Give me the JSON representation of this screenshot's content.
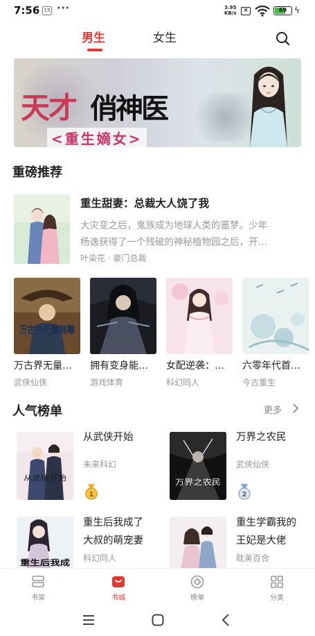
{
  "status_bar": {
    "time": "7:56",
    "badge": "15",
    "dots": "···",
    "speed_value": "3.95",
    "speed_unit": "KB/s",
    "battery": "69",
    "battery_level": 0.69
  },
  "top_tabs": {
    "male": "男生",
    "female": "女生",
    "active": "male"
  },
  "banner": {
    "title_part1": "天才",
    "title_part2": "俏神医",
    "subtitle": "<重生嫡女>"
  },
  "featured": {
    "section_title": "重磅推荐",
    "book": {
      "title": "重生甜妻：总裁大人饶了我",
      "desc_line1": "大灾变之后，鬼族成为地球人类的噩梦。少年",
      "desc_line2": "杨逸获得了一个残破的神秘植物园之后，开…",
      "author": "叶染花",
      "separator": "·",
      "category": "豪门总裁"
    },
    "grid": [
      {
        "title": "万古界无量…",
        "tag": "武侠仙侠",
        "cover_text": "万古界无量剑尊"
      },
      {
        "title": "拥有变身能…",
        "tag": "游戏体育"
      },
      {
        "title": "女配逆袭：…",
        "tag": "科幻同人"
      },
      {
        "title": "六零年代首…",
        "tag": "今古重生"
      }
    ]
  },
  "ranking": {
    "section_title": "人气榜单",
    "more": "更多",
    "items": [
      {
        "title_line1": "从武侠开始",
        "title_line2": "",
        "tag": "未来科幻",
        "rank": "1",
        "cover_text": "从武侠开始"
      },
      {
        "title_line1": "万界之农民",
        "title_line2": "",
        "tag": "武侠仙侠",
        "rank": "2",
        "cover_text": "万界之农民"
      },
      {
        "title_line1": "重生后我成了",
        "title_line2": "大叔的萌宠妻",
        "tag": "科幻同人",
        "cover_text": "重生后我成"
      },
      {
        "title_line1": "重生学霸我的",
        "title_line2": "王妃是大佬",
        "tag": "耽美百合"
      }
    ]
  },
  "bottom_nav": [
    {
      "label": "书架",
      "icon": "bookshelf-icon"
    },
    {
      "label": "书城",
      "icon": "bookstore-icon"
    },
    {
      "label": "榜单",
      "icon": "ranking-icon"
    },
    {
      "label": "分类",
      "icon": "category-icon"
    }
  ],
  "colors": {
    "accent": "#e03a35",
    "text": "#222222",
    "secondary_text": "#999999"
  }
}
